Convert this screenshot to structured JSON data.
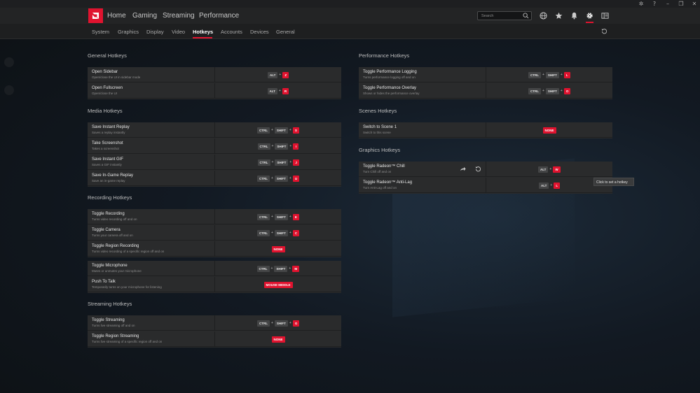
{
  "window_controls": [
    "bug-icon",
    "help-icon",
    "minimize-icon",
    "restore-icon",
    "close-icon"
  ],
  "header": {
    "nav": [
      "Home",
      "Gaming",
      "Streaming",
      "Performance"
    ],
    "search_placeholder": "Search",
    "icons": [
      "globe-icon",
      "star-icon",
      "bell-icon",
      "gear-icon",
      "sidebar-icon"
    ]
  },
  "subnav": {
    "tabs": [
      "System",
      "Graphics",
      "Display",
      "Video",
      "Hotkeys",
      "Accounts",
      "Devices",
      "General"
    ],
    "active": "Hotkeys"
  },
  "sections": {
    "general": {
      "title": "General Hotkeys",
      "rows": [
        {
          "name": "Open Sidebar",
          "desc": "Open/close the UI in sidebar mode",
          "keys": [
            "ALT",
            "Z"
          ]
        },
        {
          "name": "Open Fullscreen",
          "desc": "Open/close the UI",
          "keys": [
            "ALT",
            "R"
          ]
        }
      ]
    },
    "media": {
      "title": "Media Hotkeys",
      "rows": [
        {
          "name": "Save Instant Replay",
          "desc": "Saves a replay instantly",
          "keys": [
            "CTRL",
            "SHIFT",
            "S"
          ]
        },
        {
          "name": "Take Screenshot",
          "desc": "Takes a screenshot",
          "keys": [
            "CTRL",
            "SHIFT",
            "I"
          ]
        },
        {
          "name": "Save Instant GIF",
          "desc": "Saves a GIF instantly",
          "keys": [
            "CTRL",
            "SHIFT",
            "J"
          ]
        },
        {
          "name": "Save In-Game Replay",
          "desc": "Save an in-game replay",
          "keys": [
            "CTRL",
            "SHIFT",
            "U"
          ]
        }
      ]
    },
    "recording": {
      "title": "Recording Hotkeys",
      "rows": [
        {
          "name": "Toggle Recording",
          "desc": "Turns video recording off and on",
          "keys": [
            "CTRL",
            "SHIFT",
            "E"
          ]
        },
        {
          "name": "Toggle Camera",
          "desc": "Turns your camera off and on",
          "keys": [
            "CTRL",
            "SHIFT",
            "C"
          ]
        },
        {
          "name": "Toggle Region Recording",
          "desc": "Turns video recording of a specific region off and on",
          "keys": [
            "NONE"
          ]
        }
      ],
      "rows2": [
        {
          "name": "Toggle Microphone",
          "desc": "Mutes or unmutes your microphone",
          "keys": [
            "CTRL",
            "SHIFT",
            "M"
          ]
        },
        {
          "name": "Push To Talk",
          "desc": "Temporarily turns on your microphone for listening",
          "keys": [
            "MOUSE MIDDLE"
          ]
        }
      ]
    },
    "streaming": {
      "title": "Streaming Hotkeys",
      "rows": [
        {
          "name": "Toggle Streaming",
          "desc": "Turns live streaming off and on",
          "keys": [
            "CTRL",
            "SHIFT",
            "G"
          ]
        },
        {
          "name": "Toggle Region Streaming",
          "desc": "Turns live streaming of a specific region off and on",
          "keys": [
            "NONE"
          ]
        }
      ]
    },
    "performance": {
      "title": "Performance Hotkeys",
      "rows": [
        {
          "name": "Toggle Performance Logging",
          "desc": "Turns performance logging off and on",
          "keys": [
            "CTRL",
            "SHIFT",
            "L"
          ]
        },
        {
          "name": "Toggle Performance Overlay",
          "desc": "Shows or hides the performance overlay",
          "keys": [
            "CTRL",
            "SHIFT",
            "O"
          ]
        }
      ]
    },
    "scenes": {
      "title": "Scenes Hotkeys",
      "rows": [
        {
          "name": "Switch to Scene 1",
          "desc": "Switch to this scene",
          "keys": [
            "NONE"
          ]
        }
      ]
    },
    "graphics": {
      "title": "Graphics Hotkeys",
      "rows": [
        {
          "name": "Toggle Radeon™ Chill",
          "desc": "Turn Chill off and on",
          "keys": [
            "ALT",
            "W"
          ]
        },
        {
          "name": "Toggle Radeon™ Anti-Lag",
          "desc": "Turn Anti-Lag off and on",
          "keys": [
            "ALT",
            "L"
          ]
        }
      ]
    }
  },
  "tooltip": "Click to set a hotkey",
  "colors": {
    "accent": "#e0132f",
    "panel": "#2a2b2c",
    "header": "#232425"
  }
}
